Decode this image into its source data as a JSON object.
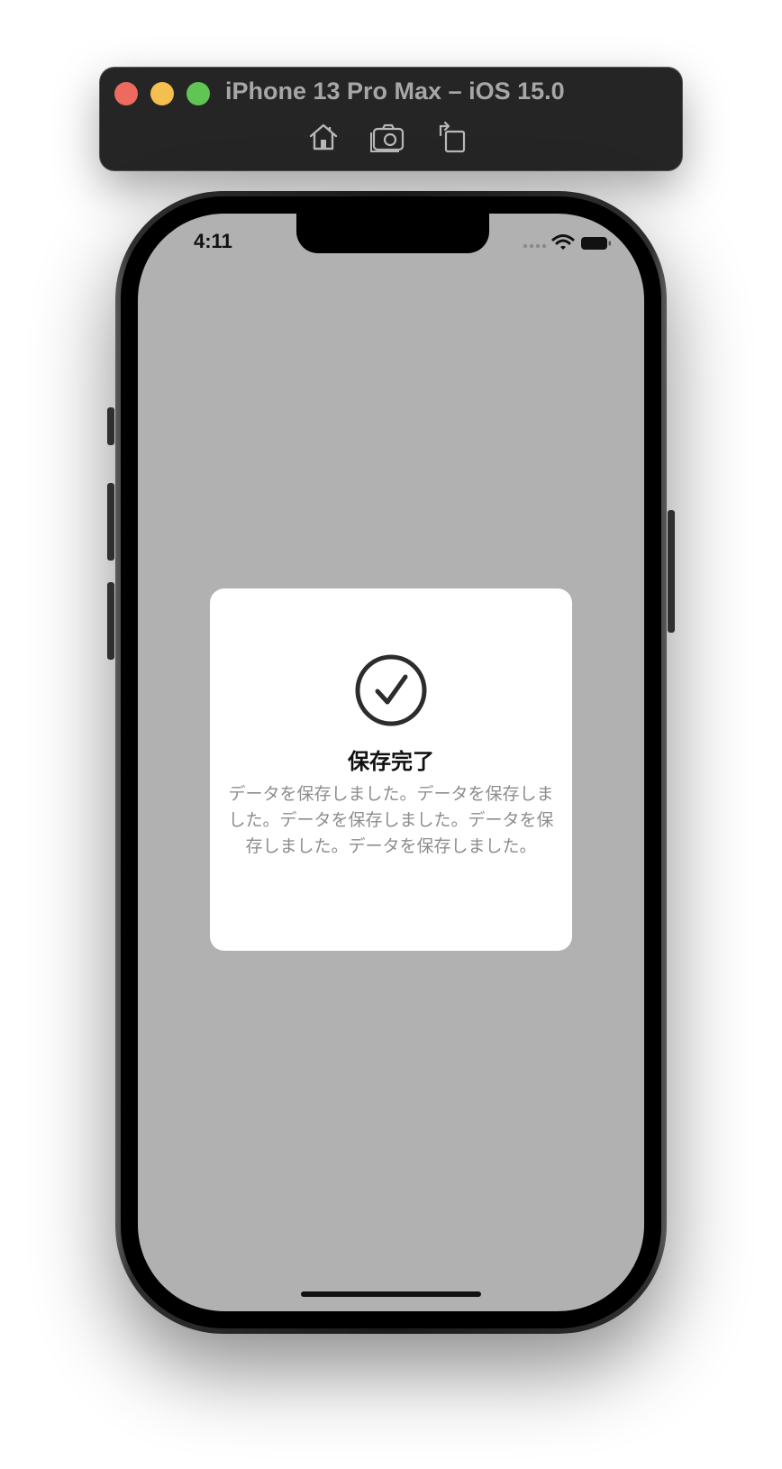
{
  "window": {
    "title": "iPhone 13 Pro Max – iOS 15.0",
    "toolbar": {
      "home_icon": "home-icon",
      "screenshot_icon": "camera-icon",
      "rotate_icon": "rotate-icon"
    },
    "traffic_colors": {
      "close": "#ed6a5e",
      "minimize": "#f5bf4f",
      "maximize": "#61c554"
    }
  },
  "status_bar": {
    "time": "4:11",
    "icons": [
      "signal-dots-icon",
      "wifi-icon",
      "battery-icon"
    ]
  },
  "dialog": {
    "icon": "checkmark-circle-icon",
    "title": "保存完了",
    "message": "データを保存しました。データを保存しました。データを保存しました。データを保存しました。データを保存しました。"
  },
  "colors": {
    "screen_overlay": "#b1b1b1",
    "dialog_background": "#ffffff",
    "message_text": "#8d8d8d"
  }
}
